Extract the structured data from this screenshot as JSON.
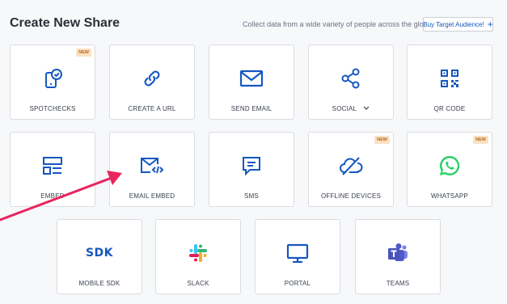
{
  "header": {
    "title": "Create New Share",
    "subtitle": "Collect data from a wide variety of people across the globe",
    "buy_button_label": "Buy Target Audience!"
  },
  "colors": {
    "accent": "#1557c0",
    "badge_bg": "#fbe1c3",
    "badge_text": "#b06a1f",
    "arrow": "#e8255f"
  },
  "cards": [
    {
      "label": "SPOTCHECKS",
      "icon": "phone-check-icon",
      "badge": "NEW"
    },
    {
      "label": "CREATE A URL",
      "icon": "link-icon"
    },
    {
      "label": "SEND EMAIL",
      "icon": "envelope-icon"
    },
    {
      "label": "SOCIAL",
      "icon": "share-icon",
      "dropdown": true
    },
    {
      "label": "QR CODE",
      "icon": "qr-code-icon"
    },
    {
      "label": "EMBED",
      "icon": "embed-layout-icon"
    },
    {
      "label": "EMAIL EMBED",
      "icon": "email-code-icon"
    },
    {
      "label": "SMS",
      "icon": "chat-bubble-icon"
    },
    {
      "label": "OFFLINE DEVICES",
      "icon": "cloud-off-icon",
      "badge": "NEW"
    },
    {
      "label": "WHATSAPP",
      "icon": "whatsapp-icon",
      "badge": "NEW"
    },
    {
      "label": "MOBILE SDK",
      "icon": "sdk-icon",
      "icon_text": "SDK"
    },
    {
      "label": "SLACK",
      "icon": "slack-icon"
    },
    {
      "label": "PORTAL",
      "icon": "monitor-icon"
    },
    {
      "label": "TEAMS",
      "icon": "teams-icon"
    }
  ]
}
